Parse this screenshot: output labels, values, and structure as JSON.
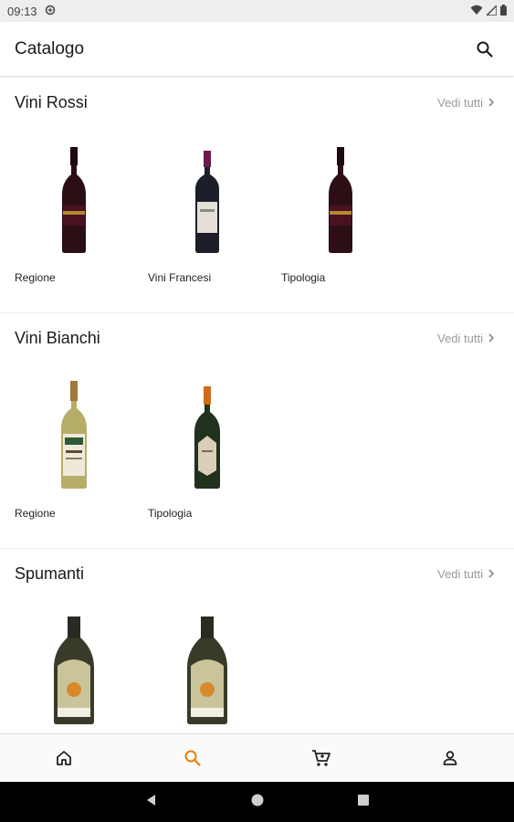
{
  "status_bar": {
    "time": "09:13"
  },
  "app_bar": {
    "title": "Catalogo"
  },
  "sections": [
    {
      "title": "Vini Rossi",
      "see_all": "Vedi tutti",
      "items": [
        {
          "label": "Regione",
          "image": "red-wine-bottle"
        },
        {
          "label": "Vini Francesi",
          "image": "bordeaux-bottle"
        },
        {
          "label": "Tipologia",
          "image": "red-wine-bottle"
        }
      ]
    },
    {
      "title": "Vini Bianchi",
      "see_all": "Vedi tutti",
      "items": [
        {
          "label": "Regione",
          "image": "white-wine-bottle"
        },
        {
          "label": "Tipologia",
          "image": "white-wine-bottle-orange-cap"
        }
      ]
    },
    {
      "title": "Spumanti",
      "see_all": "Vedi tutti",
      "items": [
        {
          "label": "",
          "image": "sparkling-bottle"
        },
        {
          "label": "",
          "image": "sparkling-bottle"
        }
      ]
    }
  ],
  "bottom_nav": [
    {
      "name": "home",
      "icon": "home-icon",
      "active": false
    },
    {
      "name": "search",
      "icon": "search-icon",
      "active": true
    },
    {
      "name": "cart",
      "icon": "cart-icon",
      "active": false
    },
    {
      "name": "account",
      "icon": "person-icon",
      "active": false
    }
  ],
  "colors": {
    "accent": "#ef7d00",
    "text": "#1a1a1a",
    "muted": "#9a9a9a"
  }
}
